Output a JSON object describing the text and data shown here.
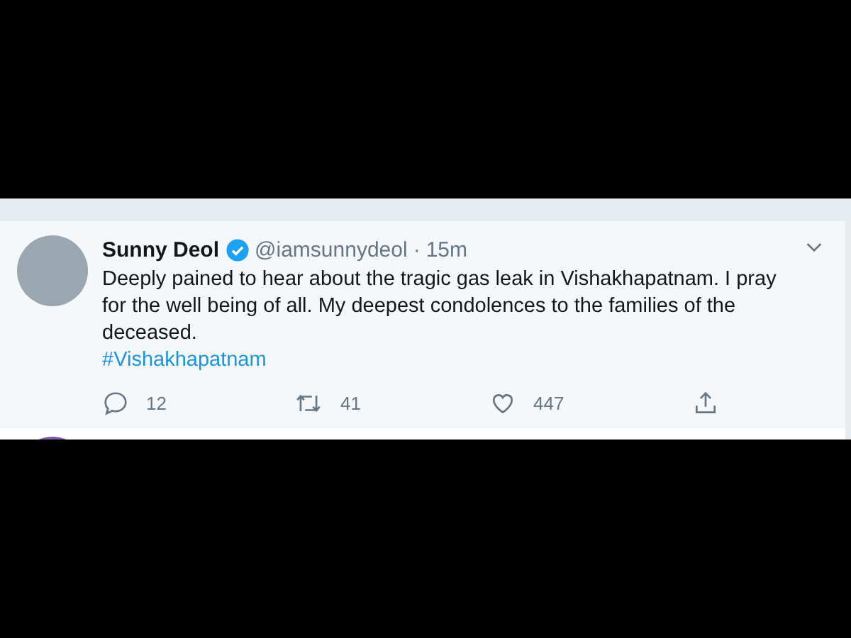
{
  "tweet": {
    "name": "Sunny Deol",
    "verified": true,
    "handle": "@iamsunnydeol",
    "separator": "·",
    "time": "15m",
    "text": "Deeply pained to hear about the tragic gas leak in Vishakhapatnam.  I pray for the well being of all. My deepest condolences to the families of the deceased.",
    "hashtag": "#Vishakhapatnam",
    "actions": [
      {
        "kind": "reply",
        "count": "12"
      },
      {
        "kind": "retweet",
        "count": "41"
      },
      {
        "kind": "like",
        "count": "447"
      },
      {
        "kind": "share"
      }
    ]
  }
}
